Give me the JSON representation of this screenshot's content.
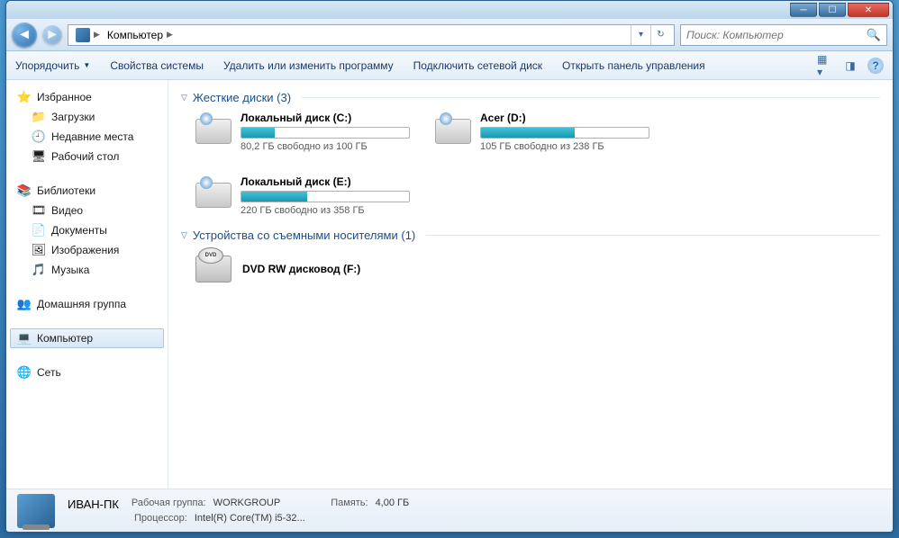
{
  "breadcrumb": {
    "root": "Компьютер"
  },
  "search": {
    "placeholder": "Поиск: Компьютер"
  },
  "toolbar": {
    "organize": "Упорядочить",
    "properties": "Свойства системы",
    "uninstall": "Удалить или изменить программу",
    "mapdrive": "Подключить сетевой диск",
    "controlpanel": "Открыть панель управления"
  },
  "sidebar": {
    "favorites": "Избранное",
    "downloads": "Загрузки",
    "recent": "Недавние места",
    "desktop": "Рабочий стол",
    "libraries": "Библиотеки",
    "videos": "Видео",
    "documents": "Документы",
    "pictures": "Изображения",
    "music": "Музыка",
    "homegroup": "Домашняя группа",
    "computer": "Компьютер",
    "network": "Сеть"
  },
  "groups": {
    "hdd": "Жесткие диски (3)",
    "removable": "Устройства со съемными носителями (1)"
  },
  "drives": [
    {
      "name": "Локальный диск (C:)",
      "status": "80,2 ГБ свободно из 100 ГБ",
      "fill": 20
    },
    {
      "name": "Acer (D:)",
      "status": "105 ГБ свободно из 238 ГБ",
      "fill": 56
    },
    {
      "name": "Локальный диск (E:)",
      "status": "220 ГБ свободно из 358 ГБ",
      "fill": 39
    }
  ],
  "removable": [
    {
      "name": "DVD RW дисковод (F:)"
    }
  ],
  "status": {
    "pcname": "ИВАН-ПК",
    "workgroup_label": "Рабочая группа:",
    "workgroup": "WORKGROUP",
    "memory_label": "Память:",
    "memory": "4,00 ГБ",
    "cpu_label": "Процессор:",
    "cpu": "Intel(R) Core(TM) i5-32..."
  }
}
